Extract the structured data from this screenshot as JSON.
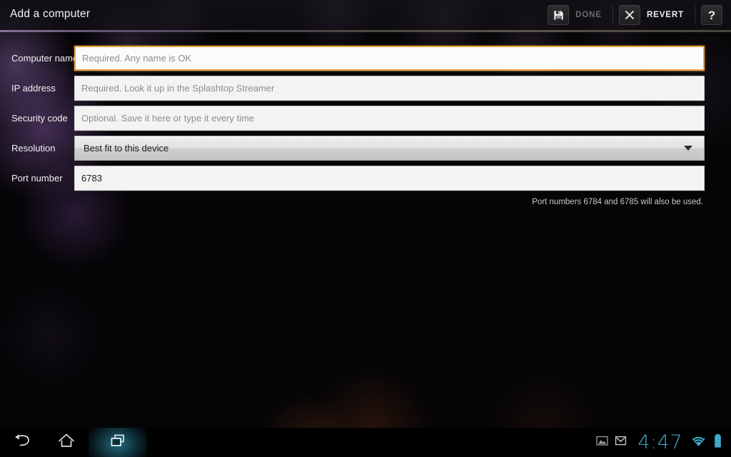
{
  "action_bar": {
    "title": "Add a computer",
    "save_icon": "floppy-disk-save-icon",
    "done_label": "DONE",
    "close_icon": "close-x-icon",
    "revert_label": "REVERT",
    "help_label": "?",
    "done_enabled": false
  },
  "form": {
    "fields": [
      {
        "label": "Computer name",
        "type": "text",
        "value": "",
        "placeholder": "Required. Any name is OK",
        "focused": true
      },
      {
        "label": "IP address",
        "type": "text",
        "value": "",
        "placeholder": "Required. Look it up in the Splashtop Streamer",
        "focused": false
      },
      {
        "label": "Security code",
        "type": "text",
        "value": "",
        "placeholder": "Optional. Save it here or type it every time",
        "focused": false
      },
      {
        "label": "Resolution",
        "type": "select",
        "value": "Best fit to this device",
        "placeholder": "",
        "focused": false
      },
      {
        "label": "Port number",
        "type": "text",
        "value": "6783",
        "placeholder": "",
        "focused": false
      }
    ],
    "hint": "Port numbers 6784 and 6785 will also be used."
  },
  "system_bar": {
    "back_icon": "back-arrow-icon",
    "home_icon": "home-icon",
    "recents_icon": "recent-apps-icon",
    "screenshot_icon": "image-notification-icon",
    "mail_icon": "mail-notification-icon",
    "clock": "4:47",
    "wifi_icon": "wifi-icon",
    "battery_icon": "battery-full-icon"
  },
  "colors": {
    "focus_border": "#e8a33d",
    "status_accent": "#3fa8c9",
    "recents_highlight": "#246e84",
    "field_bg": "#f3f3f3",
    "wallpaper_glow_purple": "#7850a0",
    "wallpaper_glow_orange": "#a0552a"
  }
}
